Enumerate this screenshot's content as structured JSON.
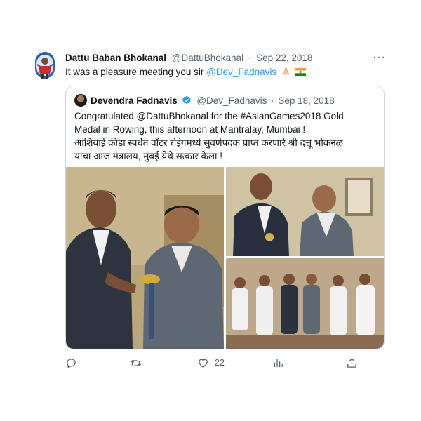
{
  "tweet": {
    "author_name": "Dattu Baban Bhokanal",
    "author_handle": "@DattuBhokanal",
    "separator": "·",
    "date": "Sep 22, 2018",
    "text_prefix": "It was a pleasure meeting you sir ",
    "text_mention": "@Dev_Fadnavis",
    "emojis": [
      "folded-hands-icon",
      "india-flag-icon"
    ]
  },
  "quoted": {
    "author_name": "Devendra Fadnavis",
    "author_handle": "@Dev_Fadnavis",
    "separator": "·",
    "date": "Sep 18, 2018",
    "lines": [
      "Congratulated @DattuBhokanal for the #AsianGames2018 Gold",
      "Medal in Rowing, this afternoon at Mantralay, Mumbai !",
      "आशियाई क्रीडा स्पर्धेत वॉटर रोइंगमध्ये सुवर्णपदक प्राप्त करणारे श्री दत्तू भोकनळ",
      "यांचा आज मंत्रालय, मुंबई येथे सत्कार केला !"
    ]
  },
  "actions": {
    "reply_count": "",
    "retweet_count": "",
    "like_count": "22",
    "views_count": ""
  },
  "colors": {
    "link": "#1d9bf0",
    "muted": "#536471",
    "border": "#cfd9de",
    "verified": "#1d9bf0"
  }
}
